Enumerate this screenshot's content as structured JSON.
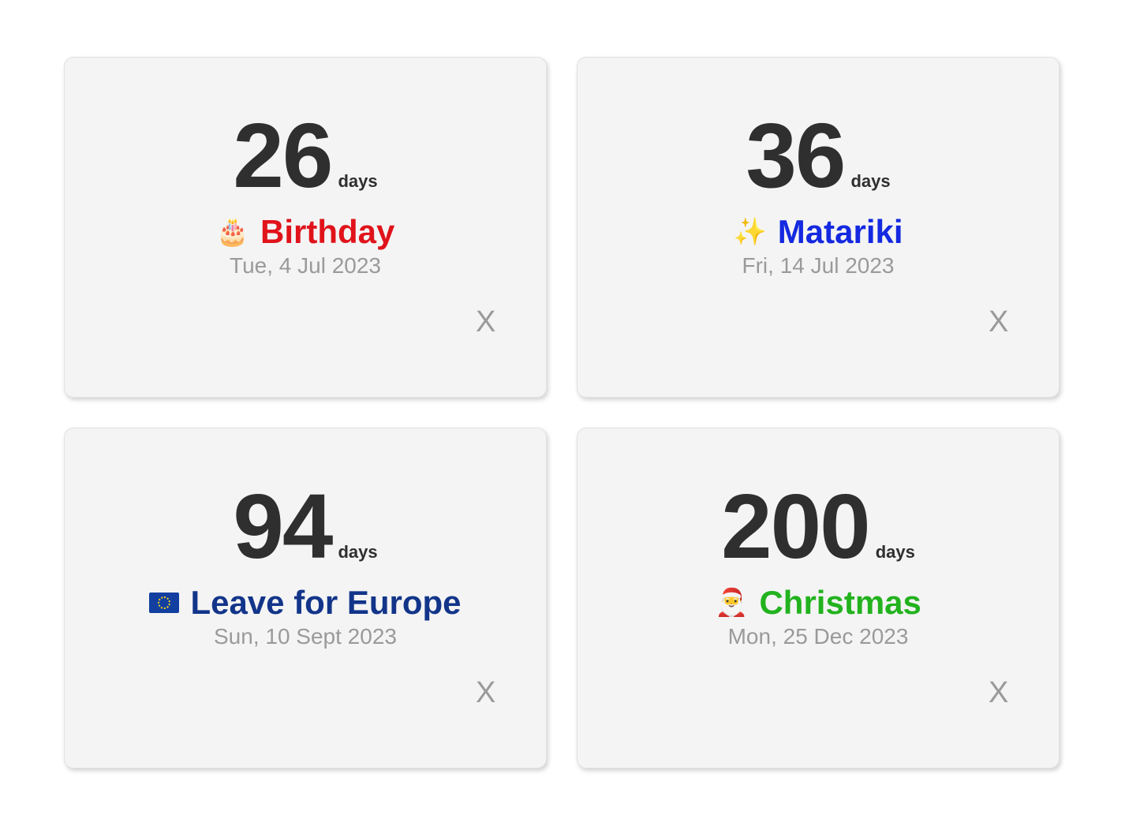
{
  "days_label": "days",
  "close_label": "X",
  "events": [
    {
      "count": "26",
      "emoji": "🎂",
      "icon": "birthday-cake-icon",
      "title": "Birthday",
      "title_color": "#e0131b",
      "date": "Tue, 4 Jul 2023"
    },
    {
      "count": "36",
      "emoji": "✨",
      "icon": "sparkles-icon",
      "title": "Matariki",
      "title_color": "#1429e0",
      "date": "Fri, 14 Jul 2023"
    },
    {
      "count": "94",
      "emoji": "🇪🇺",
      "icon": "eu-flag-icon",
      "title": "Leave for Europe",
      "title_color": "#12358a",
      "date": "Sun, 10 Sept 2023"
    },
    {
      "count": "200",
      "emoji": "🎅",
      "icon": "santa-icon",
      "title": "Christmas",
      "title_color": "#22b21e",
      "date": "Mon, 25 Dec 2023"
    }
  ]
}
